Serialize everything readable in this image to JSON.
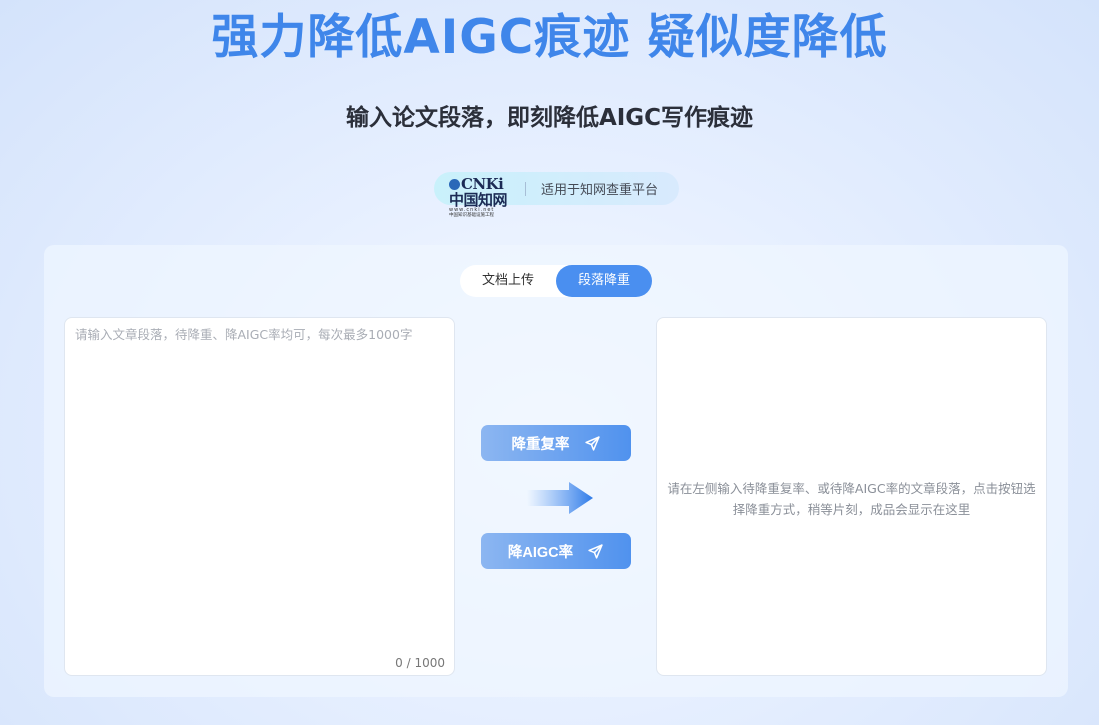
{
  "hero": {
    "title": "强力降低AIGC痕迹 疑似度降低",
    "subtitle": "输入论文段落，即刻降低AIGC写作痕迹"
  },
  "platform": {
    "logo_mark": "CNKi中国知网",
    "logo_url": "www.cnki.net",
    "logo_line": "中国知识基础设施工程",
    "text": "适用于知网查重平台"
  },
  "tabs": [
    {
      "label": "文档上传",
      "active": false
    },
    {
      "label": "段落降重",
      "active": true
    }
  ],
  "input": {
    "placeholder": "请输入文章段落，待降重、降AIGC率均可，每次最多1000字",
    "value": "",
    "counter": "0 / 1000"
  },
  "actions": {
    "rewrite_label": "降重复率",
    "aigc_label": "降AIGC率"
  },
  "output": {
    "hint": "请在左侧输入待降重复率、或待降AIGC率的文章段落，点击按钮选择降重方式，稍等片刻，成品会显示在这里"
  },
  "colors": {
    "accent": "#4a8ff0",
    "title": "#3f86ea",
    "button_start": "#8cb6f1",
    "button_end": "#5092ee"
  },
  "icons": {
    "send": "send-icon",
    "arrow": "right-arrow-icon"
  }
}
